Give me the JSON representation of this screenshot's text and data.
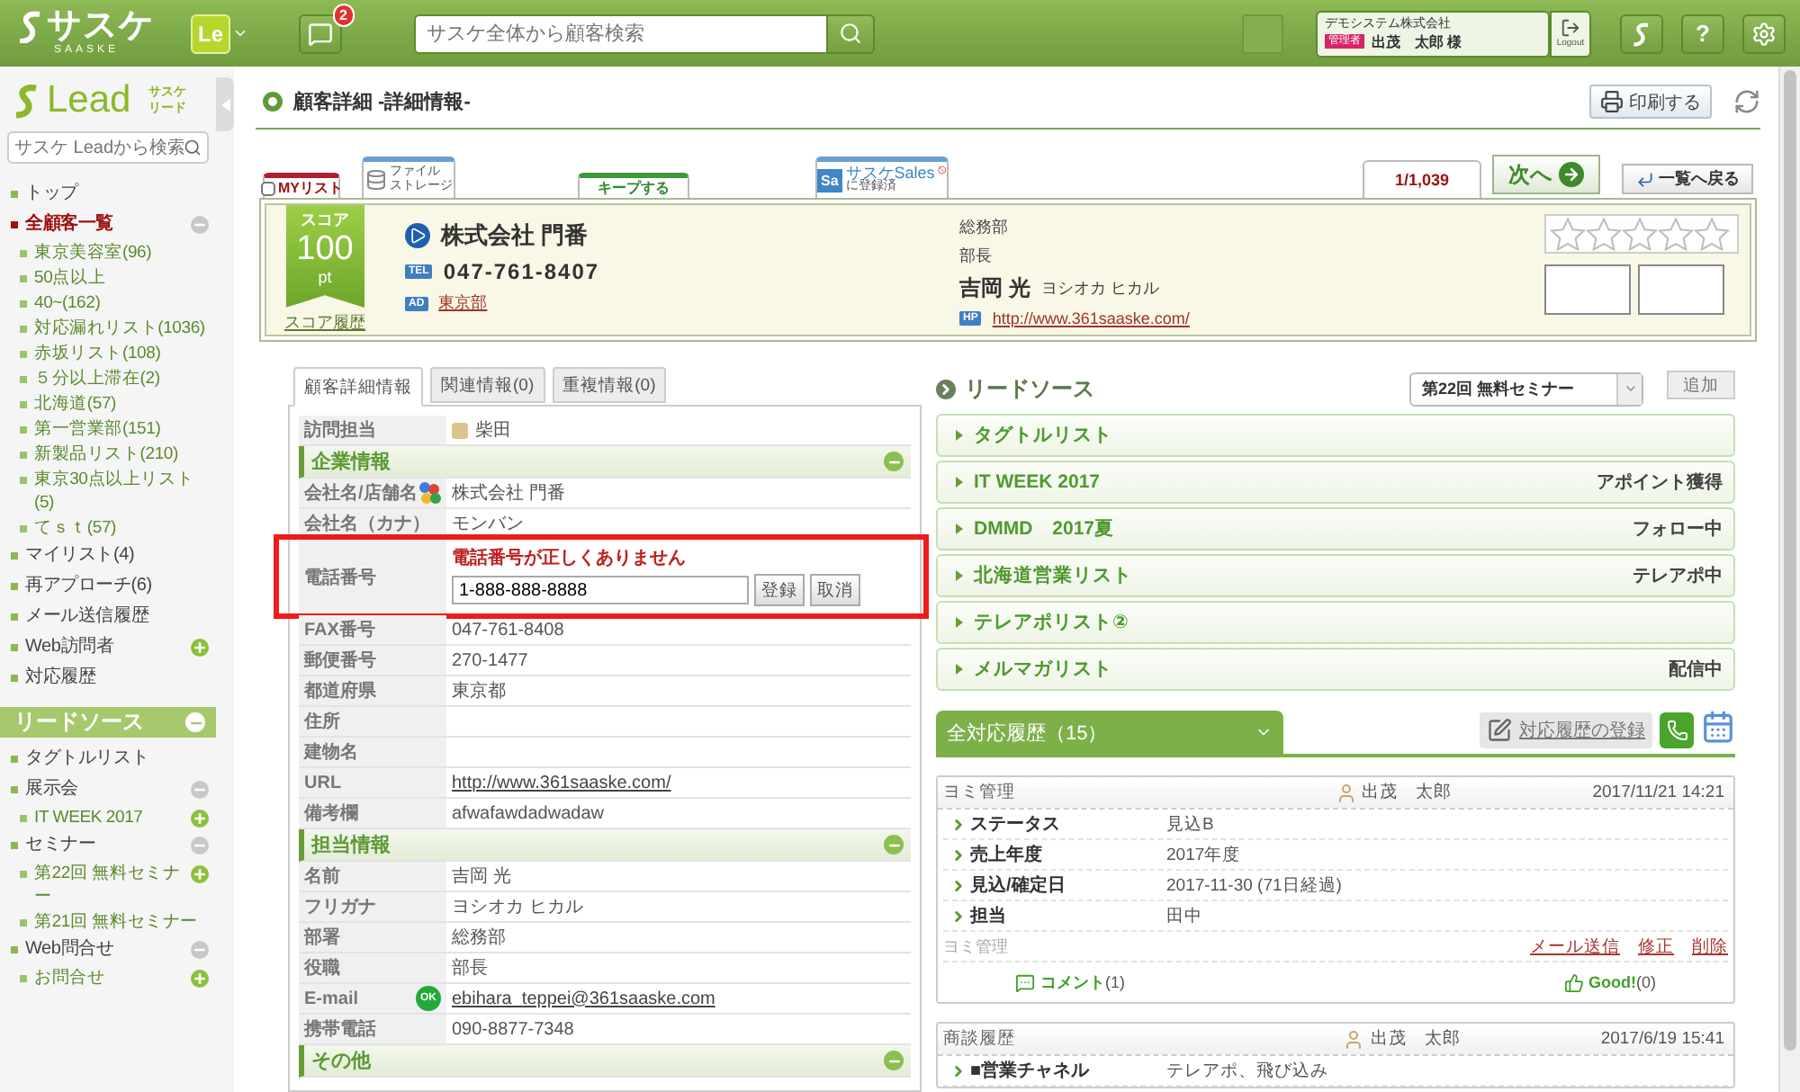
{
  "topbar": {
    "logo": "サスケ",
    "logo_sub": "SAASKE",
    "app_button": "Le",
    "notifications": "2",
    "search": {
      "placeholder": "サスケ全体から顧客検索"
    },
    "user": {
      "company": "デモシステム株式会社",
      "role": "管理者",
      "name": "出茂　太郎 様"
    },
    "logout": "Logout",
    "help": "?"
  },
  "sidebar": {
    "logo": "Lead",
    "logo_sub": [
      "サスケ",
      "リード"
    ],
    "search": {
      "placeholder": "サスケ Leadから検索"
    },
    "nav": [
      {
        "label": "トップ",
        "selected": false
      },
      {
        "label": "全顧客一覧",
        "selected": true,
        "expanded": true,
        "children": [
          {
            "label": "東京美容室(96)",
            "selected": false
          },
          {
            "label": "50点以上",
            "selected": false
          },
          {
            "label": "40~(162)",
            "selected": false
          },
          {
            "label": "対応漏れリスト(1036)",
            "selected": false
          },
          {
            "label": "赤坂リスト(108)",
            "selected": false
          },
          {
            "label": "５分以上滞在(2)",
            "selected": false
          },
          {
            "label": "北海道(57)",
            "selected": false
          },
          {
            "label": "第一営業部(151)",
            "selected": false
          },
          {
            "label": "新製品リスト(210)",
            "selected": false
          },
          {
            "label": "東京30点以上リスト(5)",
            "selected": false
          },
          {
            "label": "てｓｔ(57)",
            "selected": false
          }
        ]
      },
      {
        "label": "マイリスト(4)",
        "selected": false
      },
      {
        "label": "再アプローチ(6)",
        "selected": false
      },
      {
        "label": "メール送信履歴",
        "selected": false
      },
      {
        "label": "Web訪問者",
        "selected": false,
        "expanded": false
      },
      {
        "label": "対応履歴",
        "selected": false
      }
    ],
    "lead_section": {
      "title": "リードソース",
      "expanded": true,
      "items": [
        {
          "label": "タグトルリスト",
          "selected": false
        },
        {
          "label": "展示会",
          "selected": false,
          "expanded": true,
          "children": [
            {
              "label": "IT WEEK 2017",
              "selected": false,
              "expanded": false
            }
          ]
        },
        {
          "label": "セミナー",
          "selected": false,
          "expanded": true,
          "children": [
            {
              "label": "第22回 無料セミナー",
              "selected": false,
              "expanded": false
            },
            {
              "label": "第21回 無料セミナー",
              "selected": false
            }
          ]
        },
        {
          "label": "Web問合せ",
          "selected": false,
          "expanded": true,
          "children": [
            {
              "label": "お問合せ",
              "selected": false,
              "expanded": false
            }
          ]
        }
      ]
    }
  },
  "main": {
    "page_title": "顧客詳細 -詳細情報-",
    "print_button": "印刷する",
    "record_tabs": [
      {
        "kind": "mylist",
        "label": "MYリスト",
        "checked": false
      },
      {
        "kind": "storage",
        "lines": [
          "ファイル",
          "ストレージ"
        ]
      },
      {
        "kind": "keep",
        "label": "キープする"
      },
      {
        "kind": "sales",
        "badge": "Sa",
        "title": "サスケSales",
        "subtitle": "に登録済"
      }
    ],
    "pager": "1/1,039",
    "next_button": "次へ",
    "back_button": "一覧へ戻る",
    "customer": {
      "score_label": "スコア",
      "score": "100",
      "score_unit": "pt",
      "score_history": "スコア履歴",
      "company": "株式会社 門番",
      "tel_badge": "TEL",
      "tel": "047-761-8407",
      "area_badge": "AD",
      "area": "東京部",
      "department": "総務部",
      "position": "部長",
      "name": "吉岡 光",
      "name_kana": "ヨシオカ ヒカル",
      "hp_badge": "HP",
      "homepage": "http://www.361saaske.com/",
      "stars": 0
    },
    "detail_tabs": [
      {
        "label": "顧客詳細情報",
        "selected": true
      },
      {
        "label": "関連情報(0)",
        "selected": false
      },
      {
        "label": "重複情報(0)",
        "selected": false
      }
    ],
    "detail_rows": [
      {
        "kind": "staff",
        "label": "訪問担当",
        "value": "柴田",
        "color": "#d9c58c"
      },
      {
        "kind": "section",
        "label": "企業情報",
        "expanded": true
      },
      {
        "kind": "company",
        "label": "会社名/店舗名",
        "value": "株式会社 門番"
      },
      {
        "kind": "field",
        "label": "会社名（カナ）",
        "value": "モンバン"
      },
      {
        "kind": "edit",
        "label": "電話番号",
        "error": "電話番号が正しくありません",
        "value": "1-888-888-8888",
        "buttons": [
          "登録",
          "取消"
        ],
        "annotated": true
      },
      {
        "kind": "field",
        "label": "FAX番号",
        "value": "047-761-8408"
      },
      {
        "kind": "field",
        "label": "郵便番号",
        "value": "270-1477"
      },
      {
        "kind": "field",
        "label": "都道府県",
        "value": "東京都"
      },
      {
        "kind": "field",
        "label": "住所"
      },
      {
        "kind": "field",
        "label": "建物名"
      },
      {
        "kind": "link",
        "label": "URL",
        "value": "http://www.361saaske.com/"
      },
      {
        "kind": "field",
        "label": "備考欄",
        "value": "afwafawdadwadaw"
      },
      {
        "kind": "section",
        "label": "担当情報",
        "expanded": true
      },
      {
        "kind": "field",
        "label": "名前",
        "value": "吉岡 光"
      },
      {
        "kind": "field",
        "label": "フリガナ",
        "value": "ヨシオカ ヒカル"
      },
      {
        "kind": "field",
        "label": "部署",
        "value": "総務部"
      },
      {
        "kind": "field",
        "label": "役職",
        "value": "部長"
      },
      {
        "kind": "email",
        "label": "E-mail",
        "badge": "OK",
        "value": "ebihara_teppei@361saaske.com"
      },
      {
        "kind": "field",
        "label": "携帯電話",
        "value": "090-8877-7348"
      },
      {
        "kind": "section",
        "label": "その他",
        "expanded": true
      }
    ],
    "lead_sources": {
      "title": "リードソース",
      "select": "第22回 無料セミナー",
      "add_button": "追加",
      "items": [
        {
          "name": "タグトルリスト",
          "expanded": false
        },
        {
          "name": "IT WEEK 2017",
          "status": "アポイント獲得",
          "expanded": false
        },
        {
          "name": "DMMD　2017夏",
          "status": "フォロー中",
          "expanded": false
        },
        {
          "name": "北海道営業リスト",
          "status": "テレアポ中",
          "expanded": false
        },
        {
          "name": "テレアポリスト②",
          "expanded": false
        },
        {
          "name": "メルマガリスト",
          "status": "配信中",
          "expanded": false
        }
      ]
    },
    "history": {
      "tab": "全対応履歴（15）",
      "register_button": "対応履歴の登録",
      "cards": [
        {
          "type": "ヨミ管理",
          "user": "出茂　太郎",
          "date": "2017/11/21 14:21",
          "fields": [
            {
              "label": "ステータス",
              "value": "見込B"
            },
            {
              "label": "売上年度",
              "value": "2017年度"
            },
            {
              "label": "見込/確定日",
              "value": "2017-11-30 (71日経過)"
            },
            {
              "label": "担当",
              "value": "田中"
            }
          ],
          "footer_label": "ヨミ管理",
          "actions": [
            "メール送信",
            "修正",
            "削除"
          ],
          "comment_label": "コメント",
          "comment_count": "(1)",
          "good_label": "Good!",
          "good_count": "(0)"
        },
        {
          "type": "商談履歴",
          "user": "出茂　太郎",
          "date": "2017/6/19 15:41",
          "fields": [
            {
              "label": "■営業チャネル",
              "value": "テレアポ、飛び込み"
            }
          ]
        }
      ]
    }
  }
}
